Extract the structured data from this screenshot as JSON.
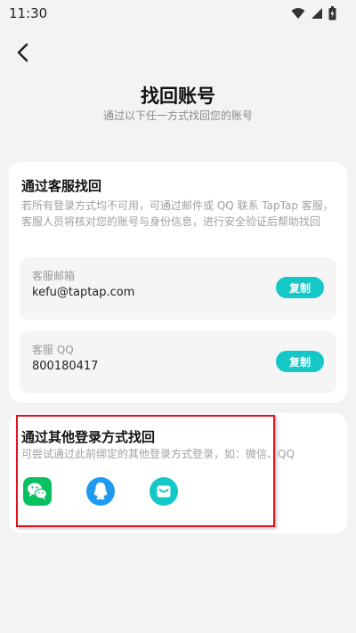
{
  "status_bar": {
    "time": "11:30",
    "icons": [
      "wifi-icon",
      "signal-icon",
      "battery-icon"
    ]
  },
  "header": {
    "title": "找回账号",
    "subtitle": "通过以下任一方式找回您的账号"
  },
  "customer_service": {
    "title": "通过客服找回",
    "description": "若所有登录方式均不可用，可通过邮件或 QQ 联系 TapTap 客服，客服人员将核对您的账号与身份信息，进行安全验证后帮助找回",
    "email": {
      "label": "客服邮箱",
      "value": "kefu@taptap.com",
      "copy_label": "复制"
    },
    "qq": {
      "label": "客服 QQ",
      "value": "800180417",
      "copy_label": "复制"
    }
  },
  "other_login": {
    "title": "通过其他登录方式找回",
    "description": "可尝试通过此前绑定的其他登录方式登录，如：微信、QQ",
    "methods": [
      "wechat-icon",
      "qq-icon",
      "taptap-login-icon"
    ]
  },
  "colors": {
    "accent": "#14c8c8",
    "wechat": "#09c160",
    "qq": "#1e9bf0",
    "highlight": "#e0141e"
  }
}
